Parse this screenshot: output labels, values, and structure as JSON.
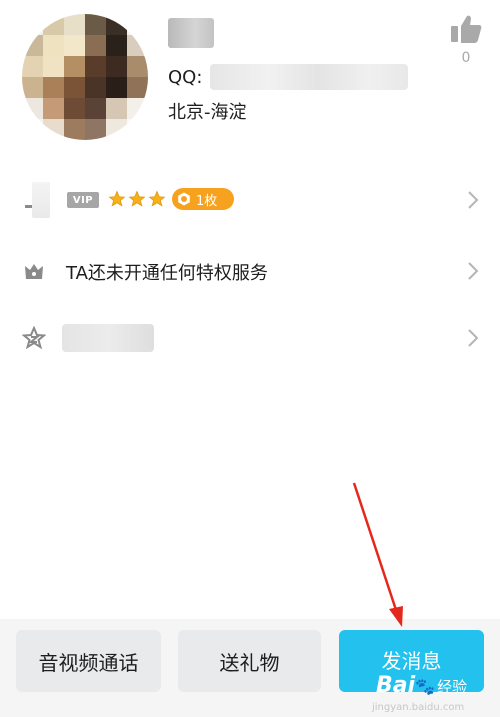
{
  "profile": {
    "qq_label": "QQ:",
    "location": "北京-海淀",
    "like_count": "0",
    "avatar_pixel_colors": [
      "#f3f0ec",
      "#d8c9a9",
      "#e8dfc8",
      "#6b5a46",
      "#3a2e25",
      "#f4f2ef",
      "#c9b89a",
      "#eee2c0",
      "#f2e8c9",
      "#8a6d52",
      "#2b211b",
      "#d9cdbd",
      "#e4d3b2",
      "#efe3c4",
      "#b48f63",
      "#5a3c2a",
      "#3d2a20",
      "#a88c6c",
      "#cbb38f",
      "#a98058",
      "#7b5438",
      "#4a3427",
      "#2a1e18",
      "#8f7258",
      "#ede8df",
      "#c49b76",
      "#6e4b34",
      "#5b4236",
      "#d6c7b5",
      "#f3efe9",
      "#f6f4f1",
      "#e8dccd",
      "#9c7b5f",
      "#8e7564",
      "#efe8df",
      "#fbfaf8"
    ]
  },
  "vip_row": {
    "vip_label": "VIP",
    "coin_label": "1枚",
    "star_count": 3,
    "colors": {
      "badge_grey": "#a6a6a6",
      "star": "#f5b117",
      "coin_badge": "#f7a21e"
    }
  },
  "privilege_row": {
    "text": "TA还未开通任何特权服务"
  },
  "bottom_bar": {
    "call_label": "音视频通话",
    "gift_label": "送礼物",
    "message_label": "发消息",
    "colors": {
      "message_button": "#22c1ee",
      "secondary_button": "#e9eaec"
    }
  },
  "watermark": {
    "logo": "Bai",
    "paw": "🐾",
    "suffix": "经验",
    "url": "jingyan.baidu.com"
  },
  "icons": {
    "like": "thumbs-up-icon",
    "privilege": "crown-icon",
    "zone": "qzone-star-icon",
    "chevron": "chevron-right-icon",
    "annotation": "red-arrow"
  }
}
